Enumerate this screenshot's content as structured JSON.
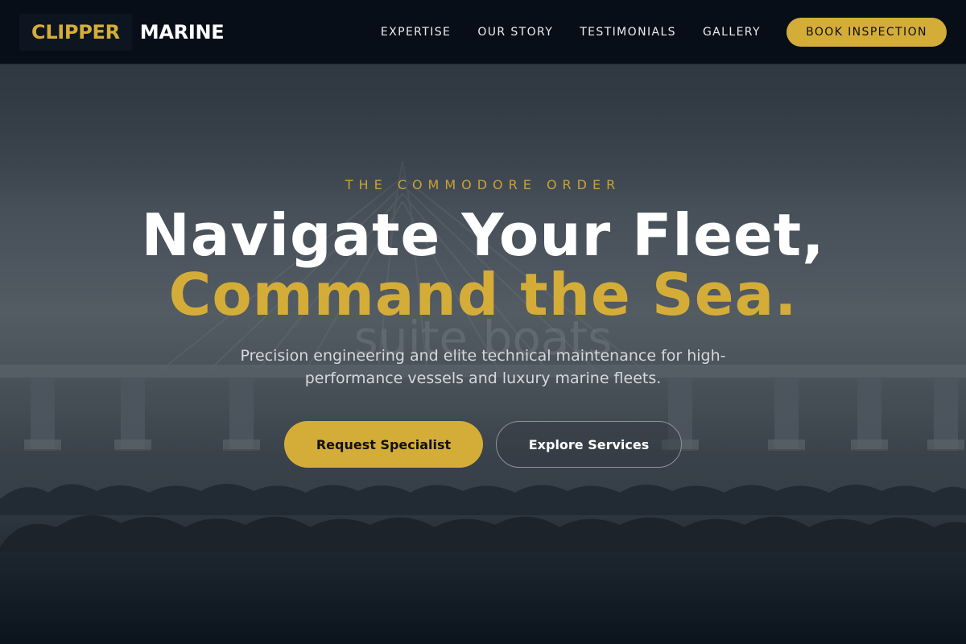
{
  "brand": {
    "name_part1": "CLIPPER",
    "name_part2": "MARINE"
  },
  "nav": {
    "links": [
      "EXPERTISE",
      "OUR STORY",
      "TESTIMONIALS",
      "GALLERY"
    ],
    "cta_label": "BOOK INSPECTION"
  },
  "hero": {
    "eyebrow": "THE COMMODORE ORDER",
    "headline_line1": "Navigate Your Fleet,",
    "headline_line2": "Command the Sea.",
    "background_watermark": "suite boats",
    "subtitle": "Precision engineering and elite technical maintenance for high-performance vessels and luxury marine fleets.",
    "primary_cta": "Request Specialist",
    "secondary_cta": "Explore Services"
  },
  "colors": {
    "accent_gold": "#d4ad38",
    "header_bg": "#070e17",
    "text_white": "#ffffff"
  }
}
